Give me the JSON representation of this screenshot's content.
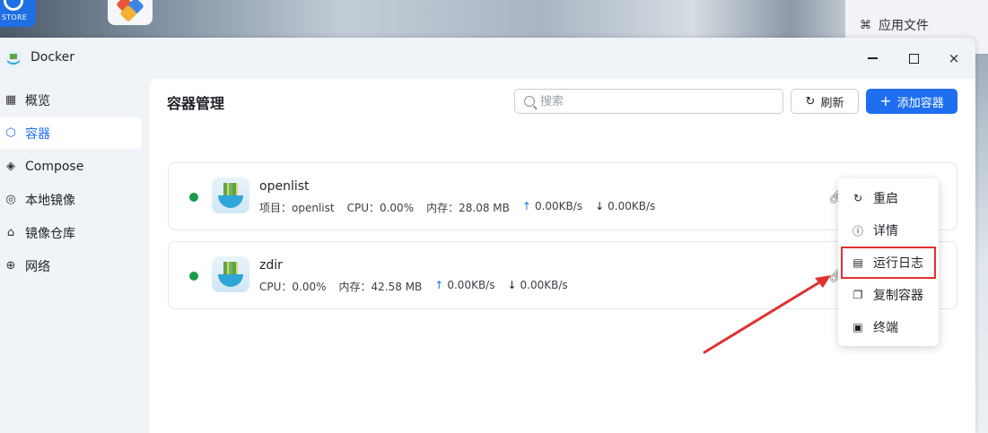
{
  "desktop": {
    "store_label": "STORE",
    "files_label": "应用文件"
  },
  "window": {
    "title": "Docker",
    "controls": {
      "minimize": "minimize",
      "maximize": "maximize",
      "close": "×"
    }
  },
  "sidebar": {
    "items": [
      {
        "label": "概览",
        "icon": "grid-icon",
        "glyph": "▦",
        "active": false
      },
      {
        "label": "容器",
        "icon": "cube-icon",
        "glyph": "⬡",
        "active": true
      },
      {
        "label": "Compose",
        "icon": "layers-icon",
        "glyph": "◈",
        "active": false
      },
      {
        "label": "本地镜像",
        "icon": "disc-icon",
        "glyph": "◎",
        "active": false
      },
      {
        "label": "镜像仓库",
        "icon": "home-icon",
        "glyph": "⌂",
        "active": false
      },
      {
        "label": "网络",
        "icon": "globe-icon",
        "glyph": "⊕",
        "active": false
      }
    ]
  },
  "main": {
    "title": "容器管理",
    "search_placeholder": "搜索",
    "refresh_label": "刷新",
    "add_label": "添加容器"
  },
  "containers": [
    {
      "name": "openlist",
      "status": "running",
      "project_label": "项目：openlist",
      "cpu": "CPU：0.00%",
      "memory": "内存：28.08 MB",
      "upload": "0.00KB/s",
      "download": "0.00KB/s"
    },
    {
      "name": "zdir",
      "status": "running",
      "cpu": "CPU：0.00%",
      "memory": "内存：42.58 MB",
      "upload": "0.00KB/s",
      "download": "0.00KB/s"
    }
  ],
  "context_menu": {
    "items": [
      {
        "label": "重启",
        "icon": "restart-icon",
        "glyph": "↻"
      },
      {
        "label": "详情",
        "icon": "info-icon",
        "glyph": "ⓘ"
      },
      {
        "label": "运行日志",
        "icon": "document-icon",
        "glyph": "▤",
        "highlighted": true
      },
      {
        "label": "复制容器",
        "icon": "copy-icon",
        "glyph": "❐"
      },
      {
        "label": "终端",
        "icon": "terminal-icon",
        "glyph": "▣"
      }
    ]
  },
  "colors": {
    "accent": "#1d6ef0",
    "running": "#1a9b4b",
    "highlight": "#e03131"
  }
}
